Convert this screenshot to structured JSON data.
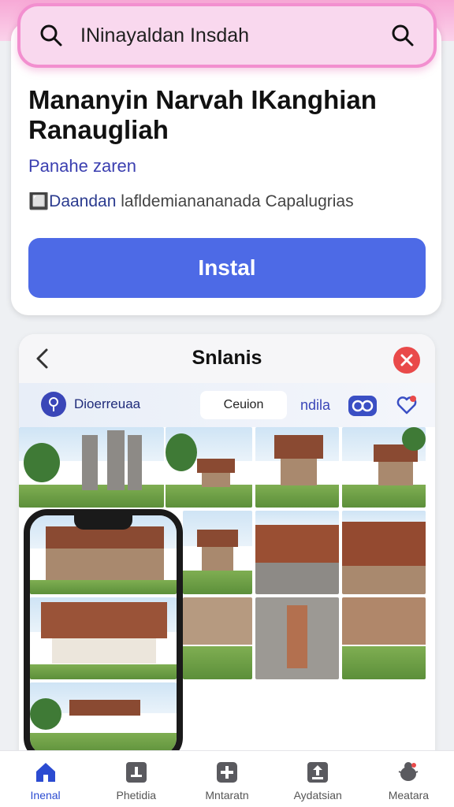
{
  "search": {
    "query": "INinayaldan Insdah"
  },
  "app": {
    "title": "Mananyin Narvah IKanghian Ranaugliah",
    "developer": "Panahe zaren",
    "meta_prefix": "🔲",
    "meta_highlight": "Daandan",
    "meta_rest": " lafldemianananada Capalugrias",
    "install_label": "Instal"
  },
  "sheet": {
    "title": "Snlanis",
    "chip_left_label": "Dioerreuaa",
    "chip_middle_label": "Ceuion",
    "chip_link_label": "ndila"
  },
  "colors": {
    "accent": "#4d6ae6",
    "search_bg": "#f9d8ee",
    "search_border": "#f28fcf",
    "close": "#e94a4a"
  },
  "bottom_nav": {
    "items": [
      {
        "label": "Inenal",
        "icon": "home-icon",
        "active": true
      },
      {
        "label": "Phetidia",
        "icon": "book-icon",
        "active": false
      },
      {
        "label": "Mntaratn",
        "icon": "plus-box-icon",
        "active": false
      },
      {
        "label": "Aydatsian",
        "icon": "upload-icon",
        "active": false
      },
      {
        "label": "Meatara",
        "icon": "bug-icon",
        "active": false
      }
    ]
  }
}
